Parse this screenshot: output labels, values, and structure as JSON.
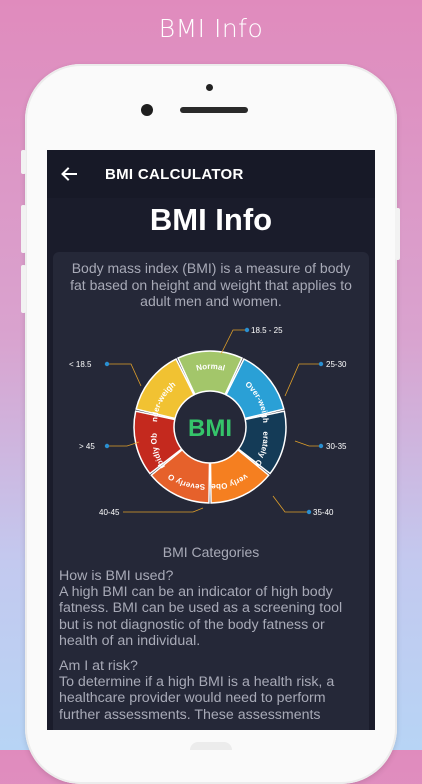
{
  "promo": {
    "title": "BMI Info"
  },
  "appbar": {
    "title": "BMI CALCULATOR",
    "back_icon": "arrow-left-icon"
  },
  "page": {
    "title": "BMI Info"
  },
  "intro": "Body mass index (BMI) is a measure of body fat based on height and weight that applies to adult men and women.",
  "chart": {
    "center_label": "BMI",
    "segments": [
      {
        "label": "Normal",
        "range": "18.5 - 25",
        "color": "#a3c66a"
      },
      {
        "label": "Over-weight",
        "range": "25-30",
        "color": "#2aa0d6"
      },
      {
        "label": "Moderately Obese",
        "range": "30-35",
        "color": "#143b57"
      },
      {
        "label": "Severly Obese",
        "range": "35-40",
        "color": "#f57f20"
      },
      {
        "label": "Very Severly Obese",
        "range": "40-45",
        "color": "#e6612b"
      },
      {
        "label": "Morbidly Obese",
        "range": "> 45",
        "color": "#c4291e"
      },
      {
        "label": "Under-weight",
        "range": "< 18.5",
        "color": "#f1c232"
      }
    ],
    "caption": "BMI Categories"
  },
  "sections": [
    {
      "question": "How is BMI used?",
      "answer": "A high BMI can be an indicator of high body fatness. BMI can be used as a screening tool but is not diagnostic of the body fatness or health of an individual."
    },
    {
      "question": "Am I at risk?",
      "answer": "To determine if a high BMI is a health risk, a healthcare provider would need to perform further assessments. These assessments"
    }
  ]
}
